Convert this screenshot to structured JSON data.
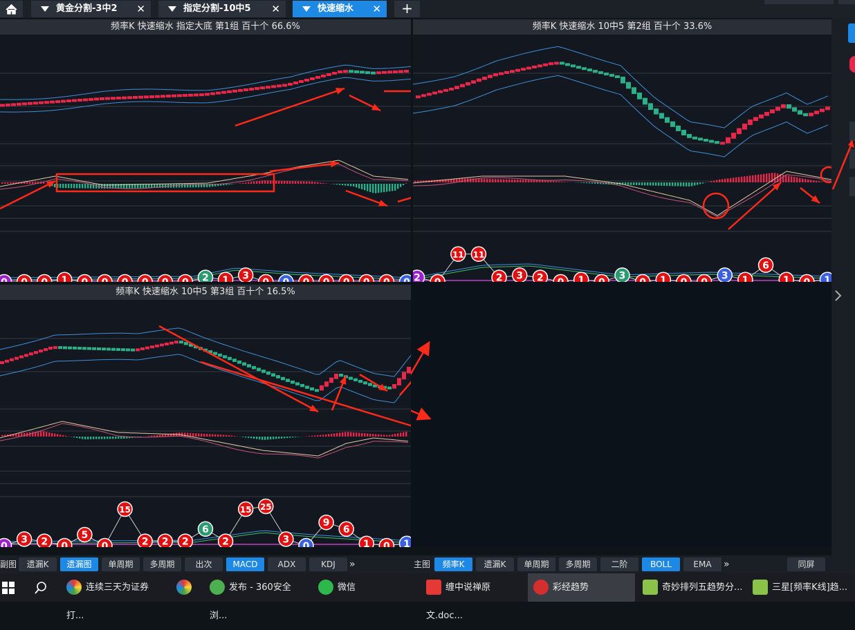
{
  "tabs": [
    {
      "label": "黄金分割-3中2"
    },
    {
      "label": "指定分割-10中5"
    },
    {
      "label": "快速缩水"
    }
  ],
  "panels": [
    {
      "title": "频率K  快速缩水  指定大底 第1组  百十个  66.6%"
    },
    {
      "title": "频率K  快速缩水  10中5 第2组  百十个  33.6%"
    },
    {
      "title": "频率K  快速缩水  10中5 第3组  百十个  16.5%"
    }
  ],
  "badges": {
    "p1": [
      "0",
      "0",
      "0",
      "1",
      "0",
      "0",
      "0",
      "0",
      "0",
      "0",
      "2",
      "1",
      "3",
      "0",
      "0",
      "0",
      "0",
      "0",
      "0",
      "0",
      "0"
    ],
    "p2": [
      "2",
      "0",
      "11",
      "11",
      "2",
      "3",
      "2",
      "0",
      "1",
      "0",
      "3",
      "0",
      "1",
      "0",
      "0",
      "3",
      "1",
      "6",
      "1",
      "0",
      "1"
    ],
    "p3": [
      "0",
      "3",
      "2",
      "0",
      "5",
      "0",
      "15",
      "2",
      "2",
      "2",
      "6",
      "2",
      "15",
      "25",
      "3",
      "0",
      "9",
      "6",
      "1",
      "0",
      "1"
    ]
  },
  "bottom_left": {
    "label": "副图",
    "buttons": [
      "遗漏K",
      "遗漏图",
      "单周期",
      "多周期",
      "出次",
      "MACD",
      "ADX",
      "KDJ"
    ],
    "more": "»"
  },
  "bottom_right": {
    "label": "主图",
    "buttons": [
      "频率K",
      "遗漏K",
      "单周期",
      "多周期",
      "二阶",
      "BOLL",
      "EMA"
    ],
    "more": "»",
    "fullscreen": "同屏"
  },
  "taskbar": [
    {
      "label": "连续三天为证券打..."
    },
    {
      "label": ""
    },
    {
      "label": "发布 - 360安全浏..."
    },
    {
      "label": "微信"
    },
    {
      "label": "缠中说禅原文.doc..."
    },
    {
      "label": "彩经趋势"
    },
    {
      "label": "奇妙排列五趋势分..."
    },
    {
      "label": "三星[频率K线]趋..."
    }
  ],
  "colors": {
    "up": "#e8284a",
    "down": "#2bb08a",
    "band": "#3f8fd8",
    "arrow": "#ff2a1a",
    "tab_active": "#1e88e5"
  }
}
